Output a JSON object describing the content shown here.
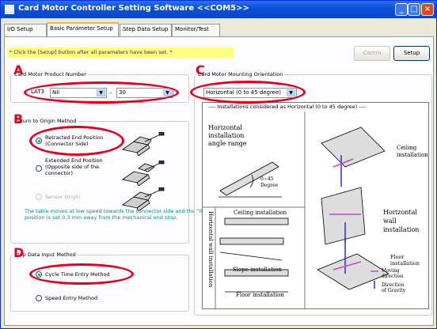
{
  "window": {
    "title": "Card Motor Controller Setting Software <<COM5>>"
  },
  "tabs": [
    {
      "label": "I/O Setup"
    },
    {
      "label": "Basic Parameter Setup"
    },
    {
      "label": "Step Data Setup"
    },
    {
      "label": "Monitor/Test"
    }
  ],
  "notice": "* Click the [Setup] button after all parameters have been set. *",
  "buttons": {
    "comm": "Comm",
    "setup": "Setup"
  },
  "annotations": {
    "a": "A",
    "b": "B",
    "c": "C",
    "d": "D"
  },
  "product": {
    "label": "Card Motor Product Number",
    "series": "LAT3",
    "option": "Nil",
    "separator": "-",
    "stroke": "30"
  },
  "origin": {
    "label": "Return to Origin Method",
    "options": [
      {
        "label": "Retracted End Position (Connector Side)",
        "selected": true,
        "enabled": true
      },
      {
        "label": "Extended End Position (Opposite side of the connector)",
        "selected": false,
        "enabled": true
      },
      {
        "label": "Sensor Origin",
        "selected": false,
        "enabled": false
      }
    ],
    "description": "The table moves at low speed towards the connector side and the \"0\" position is set 0.3 mm away from the mechanical end stop."
  },
  "step_input": {
    "label": "Step Data Input Method",
    "options": [
      {
        "label": "Cycle Time Entry Method",
        "selected": true
      },
      {
        "label": "Speed Entry Method",
        "selected": false
      }
    ]
  },
  "mounting": {
    "label": "Card Motor Mounting Orientation",
    "value": "Horizontal (0 to 45 degree)",
    "caption": "---- Installations considered as Horizontal (0 to 45 degree) ----",
    "texts": {
      "horiz_range_1": "Horizontal",
      "horiz_range_2": "installation",
      "horiz_range_3": "angle range",
      "deg_1": "0~45",
      "deg_2": "Degree",
      "ceiling_right_1": "Ceiling",
      "ceiling_right_2": "installation",
      "wall_right_1": "Horizontal",
      "wall_right_2": "wall",
      "wall_right_3": "installation",
      "floor_right_1": "Floor",
      "floor_right_2": "installation",
      "ceiling_left": "Ceiling installation",
      "slope_left": "Slope installation",
      "floor_left": "Floor installation",
      "vertical_wall": "Horizontal wall installation",
      "legend_moving_1": "Moving",
      "legend_moving_2": "direction",
      "legend_gravity_1": "Direction",
      "legend_gravity_2": "of Gravity"
    }
  }
}
